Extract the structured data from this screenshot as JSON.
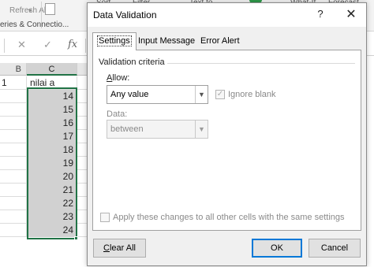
{
  "ribbon": {
    "refresh_all": "Refresh All",
    "queries_connections": "eries & Connectio...",
    "sort": "Sort",
    "filter": "Filter",
    "text_to": "Text to",
    "what_if": "What-If",
    "forecast": "Forecast"
  },
  "formula_bar": {
    "cancel": "✕",
    "enter": "✓",
    "fx": "fx"
  },
  "grid": {
    "columns": [
      "B",
      "C"
    ],
    "header_row": {
      "row_num": "1",
      "value": "nilai a"
    },
    "values": [
      "14",
      "15",
      "16",
      "17",
      "18",
      "19",
      "20",
      "21",
      "22",
      "23",
      "24"
    ]
  },
  "dialog": {
    "title": "Data Validation",
    "help": "?",
    "close": "✕",
    "tabs": [
      "Settings",
      "Input Message",
      "Error Alert"
    ],
    "criteria_label": "Validation criteria",
    "allow_label_accel": "A",
    "allow_label_rest": "llow:",
    "allow_value": "Any value",
    "ignore_blank_label": "Ignore blank",
    "ignore_blank_checked": true,
    "data_label": "Data:",
    "data_value": "between",
    "apply_label": "Apply these changes to all other cells with the same settings",
    "apply_checked": false,
    "buttons": {
      "clear_accel": "C",
      "clear_rest": "lear All",
      "ok": "OK",
      "cancel": "Cancel"
    }
  },
  "colors": {
    "selection_border": "#217346",
    "selection_fill": "#d1d1d1",
    "ok_border": "#0078d7"
  },
  "icons": [
    "cancel-icon",
    "enter-icon",
    "fx-icon",
    "dropdown-arrow-icon",
    "checkbox-icon",
    "close-icon",
    "help-icon"
  ]
}
